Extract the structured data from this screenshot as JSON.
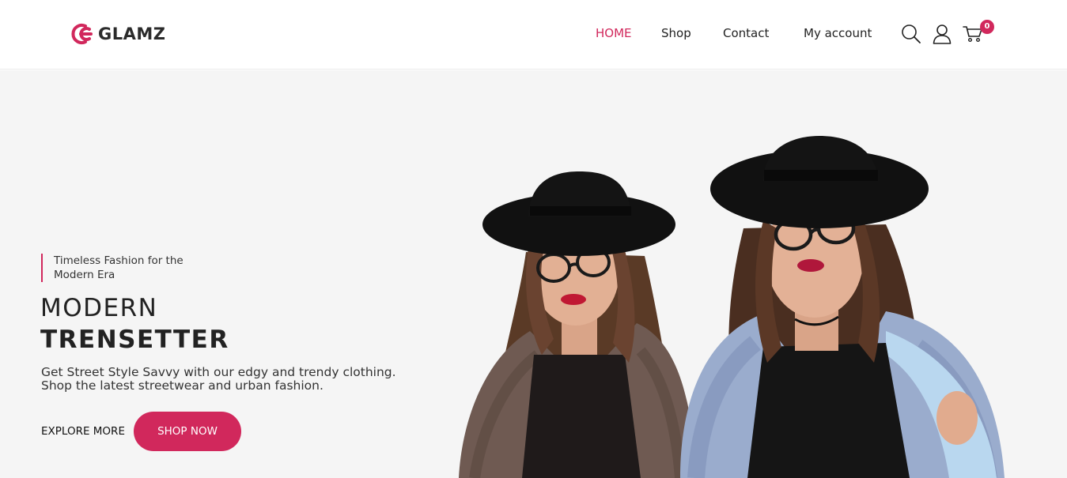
{
  "brand": {
    "name": "GLAMZ",
    "accent_color": "#d1285c"
  },
  "nav": {
    "items": [
      {
        "label": "HOME",
        "active": true
      },
      {
        "label": "Shop",
        "active": false
      },
      {
        "label": "Contact",
        "active": false
      },
      {
        "label": "My account",
        "active": false
      }
    ]
  },
  "header_icons": {
    "search": "search-icon",
    "account": "user-icon",
    "cart": "cart-icon",
    "cart_count": "0"
  },
  "hero": {
    "tagline": "Timeless Fashion for the Modern Era",
    "heading_line1": "MODERN",
    "heading_line2": "TRENSETTER",
    "description": "Get Street Style Savvy with our edgy and trendy clothing. Shop the latest streetwear and urban fashion.",
    "explore_label": "EXPLORE MORE",
    "shop_label": "SHOP NOW",
    "image": "two women wearing black hats, glasses and fur coats"
  }
}
